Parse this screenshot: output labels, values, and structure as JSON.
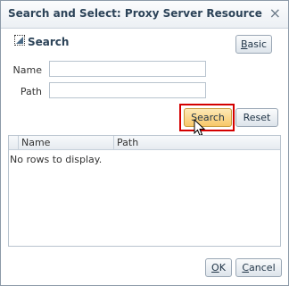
{
  "dialog": {
    "title": "Search and Select: Proxy Server Resource",
    "close_glyph": "×"
  },
  "search_panel": {
    "title": "Search",
    "basic_button": {
      "underlined": "B",
      "rest": "asic"
    },
    "fields": [
      {
        "label": "Name",
        "value": ""
      },
      {
        "label": "Path",
        "value": ""
      }
    ],
    "search_button": "Search",
    "reset_button": "Reset"
  },
  "results_table": {
    "columns": [
      "Name",
      "Path"
    ],
    "empty_message": "No rows to display."
  },
  "footer": {
    "ok_button": {
      "underlined": "O",
      "rest": "K"
    },
    "cancel_button": {
      "underlined": "C",
      "rest": "ancel"
    }
  },
  "colors": {
    "highlight_border": "#d40000",
    "search_button_fill": "#f8c86a",
    "title_text": "#2c4358"
  },
  "icons": {
    "disclosure": "disclosure-triangle-icon",
    "cursor": "mouse-pointer-icon"
  }
}
